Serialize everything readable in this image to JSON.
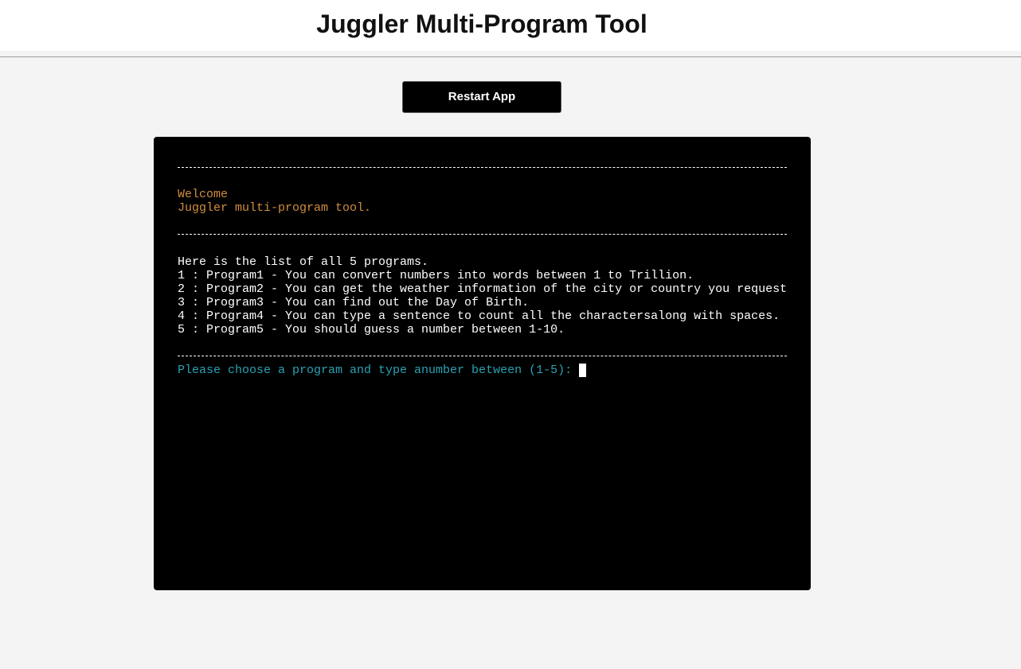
{
  "header": {
    "title": "Juggler Multi-Program Tool"
  },
  "toolbar": {
    "restart_label": "Restart App"
  },
  "terminal": {
    "welcome_line1": "Welcome",
    "welcome_line2": "Juggler multi-program tool.",
    "list_intro": "Here is the list of all 5 programs.",
    "programs": [
      "1 : Program1 - You can convert numbers into words between 1 to Trillion.",
      "2 : Program2 - You can get the weather information of the city or country you request",
      "3 : Program3 - You can find out the Day of Birth.",
      "4 : Program4 - You can type a sentence to count all the charactersalong with spaces.",
      "5 : Program5 - You should guess a number between 1-10."
    ],
    "prompt": "Please choose a program and type anumber between (1-5):"
  },
  "colors": {
    "terminal_background": "#000000",
    "welcome_text": "#d08c3e",
    "prompt_text": "#2aa1b3",
    "page_background": "#f4f4f4"
  }
}
